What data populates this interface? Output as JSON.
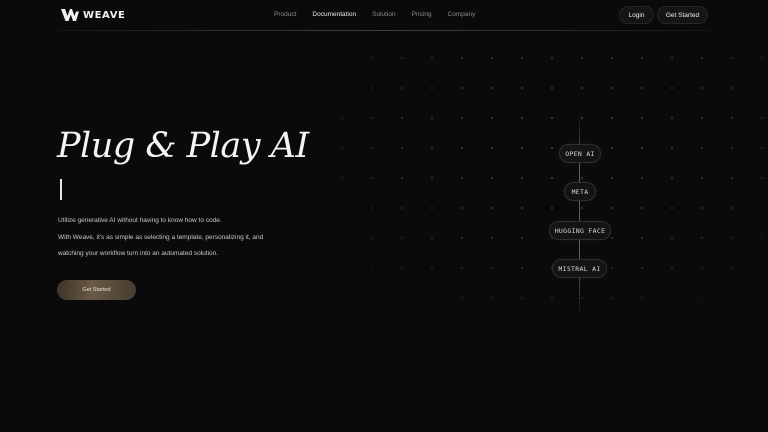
{
  "brand": {
    "name": "WEAVE",
    "logo_icon": "weave-w-icon"
  },
  "nav": {
    "links": [
      "Product",
      "Documentation",
      "Solution",
      "Pricing",
      "Company"
    ],
    "active_link": "Documentation",
    "login_label": "Login",
    "get_started_label": "Get Started"
  },
  "hero": {
    "title": "Plug & Play AI",
    "lines": [
      "Utilize generative AI without having to know how to code.",
      "With Weave, it's as simple as selecting a template, personalizing it, and",
      "watching your workflow turn into an automated solution."
    ],
    "cta_label": "Get Started"
  },
  "providers": [
    "OPEN AI",
    "META",
    "HUGGING FACE",
    "MISTRAL AI"
  ],
  "colors": {
    "background": "#0a0a0c",
    "cta_gradient_mid": "#6a5a45",
    "text_primary": "#f4f4f4",
    "text_muted": "#8b8b8f"
  }
}
